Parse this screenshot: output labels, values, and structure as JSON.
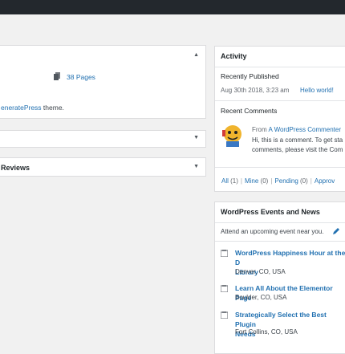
{
  "glance": {
    "pages_link": "38 Pages",
    "theme_text_link": "eneratePress",
    "theme_text_suffix": " theme."
  },
  "reviews_panel": {
    "title": "Reviews"
  },
  "activity": {
    "title": "Activity",
    "recently_published": {
      "heading": "Recently Published",
      "date": "Aug 30th 2018, 3:23 am",
      "post_title": "Hello world!"
    },
    "recent_comments": {
      "heading": "Recent Comments",
      "from_prefix": "From",
      "author": "A WordPress Commenter",
      "excerpt_line1": "Hi, this is a comment. To get sta",
      "excerpt_line2": "comments, please visit the Com"
    },
    "filters": [
      {
        "label": "All",
        "count": "(1)"
      },
      {
        "label": "Mine",
        "count": "(0)"
      },
      {
        "label": "Pending",
        "count": "(0)"
      },
      {
        "label": "Approv",
        "count": ""
      }
    ]
  },
  "events": {
    "title": "WordPress Events and News",
    "intro": "Attend an upcoming event near you.",
    "items": [
      {
        "title_line1": "WordPress Happiness Hour at the D",
        "title_line2": "Library",
        "location": "Denver, CO, USA"
      },
      {
        "title_line1": "Learn All About the Elementor Page",
        "title_line2": "",
        "location": "Boulder, CO, USA"
      },
      {
        "title_line1": "Strategically Select the Best Plugin",
        "title_line2": "Needs",
        "location": "Fort Collins, CO, USA"
      }
    ]
  },
  "colors": {
    "link": "#2271b1",
    "admin_bar": "#23282d",
    "background": "#f1f1f1"
  },
  "icons": [
    "pages-icon",
    "collapse-up-icon",
    "collapse-down-icon",
    "avatar-icon",
    "pencil-icon",
    "event-icon"
  ]
}
